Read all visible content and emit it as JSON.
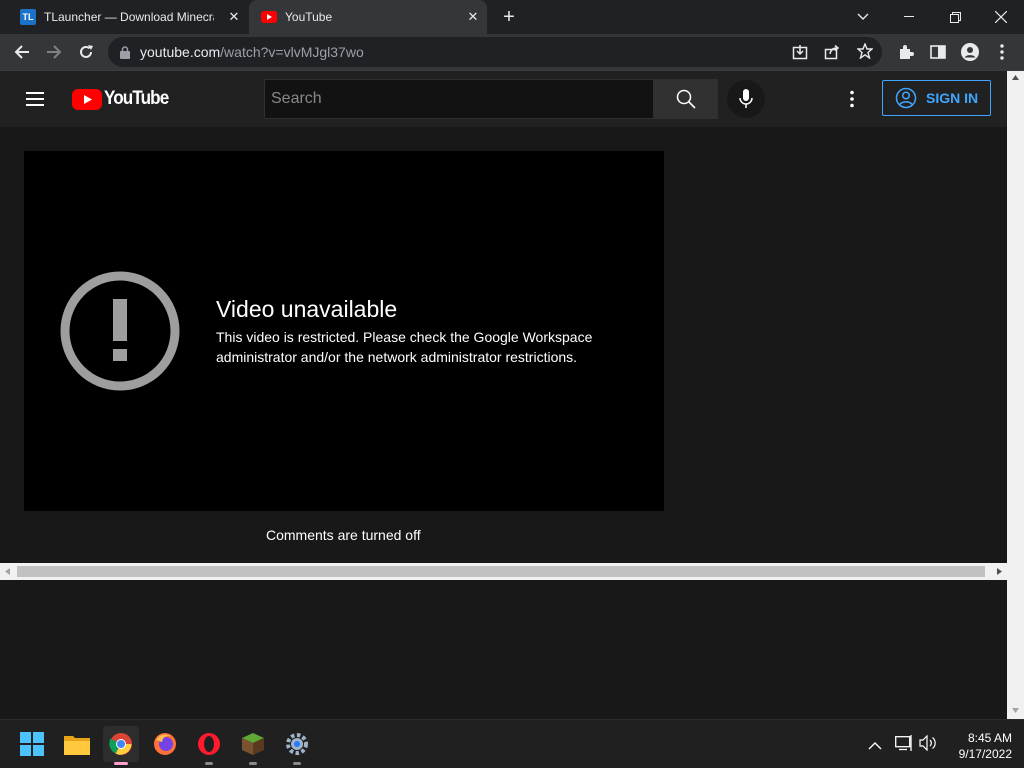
{
  "browser": {
    "tabs": [
      {
        "title": "TLauncher — Download Minecraft",
        "favicon": "tlauncher-icon",
        "fav_text": "TL",
        "close": "✕"
      },
      {
        "title": "YouTube",
        "favicon": "youtube-icon",
        "close": "✕",
        "active": true
      }
    ],
    "new_tab": "+",
    "address": {
      "host": "youtube.com",
      "path": "/watch?v=vlvMJgl37wo"
    }
  },
  "youtube": {
    "logo_text": "YouTube",
    "search_placeholder": "Search",
    "sign_in": "SIGN IN",
    "error_title": "Video unavailable",
    "error_message": "This video is restricted. Please check the Google Workspace administrator and/or the network administrator restrictions.",
    "comments": "Comments are turned off"
  },
  "taskbar": {
    "apps": [
      "start-icon",
      "file-explorer-icon",
      "chrome-icon",
      "firefox-icon",
      "opera-icon",
      "minecraft-icon",
      "settings-icon"
    ],
    "time": "8:45 AM",
    "date": "9/17/2022"
  },
  "colors": {
    "accent_blue": "#3ea6ff",
    "youtube_red": "#ff0000",
    "chrome_bg": "#202124",
    "page_bg": "#181818"
  }
}
